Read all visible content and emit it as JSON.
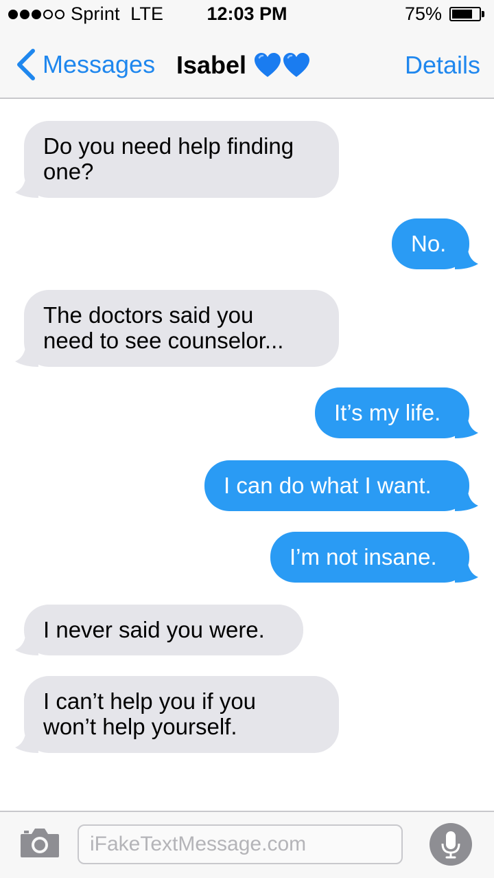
{
  "status_bar": {
    "carrier": "Sprint  LTE",
    "time": "12:03 PM",
    "battery_percent": "75%",
    "battery_level": 0.75,
    "signal_bars_filled": 3,
    "signal_bars_total": 5
  },
  "nav": {
    "back_label": "Messages",
    "title": "Isabel",
    "title_icons": [
      "blue-heart-icon",
      "blue-heart-icon"
    ],
    "details_label": "Details",
    "accent_color": "#1f87ee"
  },
  "messages": [
    {
      "direction": "incoming",
      "text": "Do you need help finding\none?"
    },
    {
      "direction": "outgoing",
      "text": "No."
    },
    {
      "direction": "incoming",
      "text": "The doctors said you\nneed to see counselor..."
    },
    {
      "direction": "outgoing",
      "text": "It’s my life."
    },
    {
      "direction": "outgoing",
      "text": "I can do what I want."
    },
    {
      "direction": "outgoing",
      "text": "I’m not insane."
    },
    {
      "direction": "incoming",
      "text": "I never said you were."
    },
    {
      "direction": "incoming",
      "text": "I can’t help you if you\nwon’t help yourself."
    }
  ],
  "colors": {
    "incoming_bubble": "#e5e5ea",
    "outgoing_bubble": "#2a9bf4",
    "heart": "#1a7cf0"
  },
  "input_bar": {
    "placeholder": "iFakeTextMessage.com",
    "left_icon": "camera-icon",
    "right_icon": "microphone-icon"
  }
}
